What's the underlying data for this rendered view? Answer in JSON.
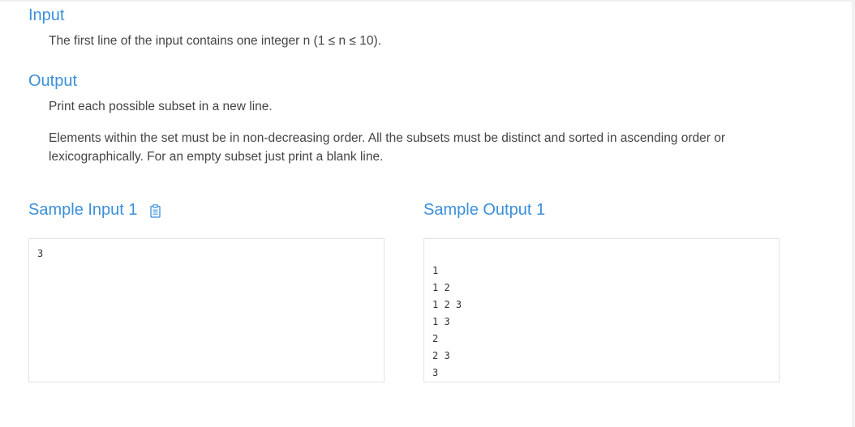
{
  "sections": {
    "input": {
      "heading": "Input",
      "text": "The first line of the input contains one integer n (1 ≤ n ≤ 10)."
    },
    "output": {
      "heading": "Output",
      "text1": "Print each possible subset in a new line.",
      "text2": "Elements within the set must be in non-decreasing order. All the subsets must be distinct and sorted in ascending order or lexicographically. For an empty subset just print a blank line."
    }
  },
  "samples": {
    "input": {
      "heading": "Sample Input 1",
      "copy_icon": "clipboard-icon",
      "lines": [
        "3"
      ]
    },
    "output": {
      "heading": "Sample Output 1",
      "lines": [
        "",
        "1",
        "1 2",
        "1 2 3",
        "1 3",
        "2",
        "2 3",
        "3"
      ]
    }
  },
  "colors": {
    "heading": "#3b8fd9",
    "text": "#444444",
    "box_border": "#e3e3e3"
  }
}
